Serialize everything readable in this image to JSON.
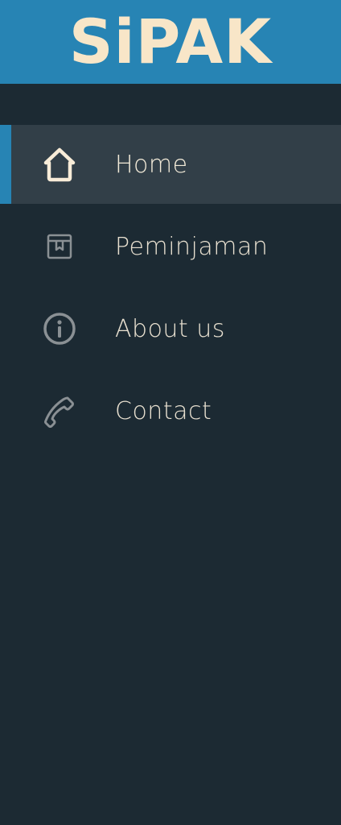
{
  "header": {
    "brand": "SiPAK"
  },
  "colors": {
    "header_bg": "#2784b4",
    "sidebar_bg": "#1c2a33",
    "active_bg": "#323f48",
    "accent": "#2784b4",
    "brand_text": "#f8e6c8",
    "icon": "#8a9094",
    "active_icon": "#f8ecd8"
  },
  "nav": {
    "items": [
      {
        "label": "Home",
        "icon": "home-icon",
        "active": true
      },
      {
        "label": "Peminjaman",
        "icon": "box-icon",
        "active": false
      },
      {
        "label": "About us",
        "icon": "info-icon",
        "active": false
      },
      {
        "label": "Contact",
        "icon": "phone-icon",
        "active": false
      }
    ]
  }
}
